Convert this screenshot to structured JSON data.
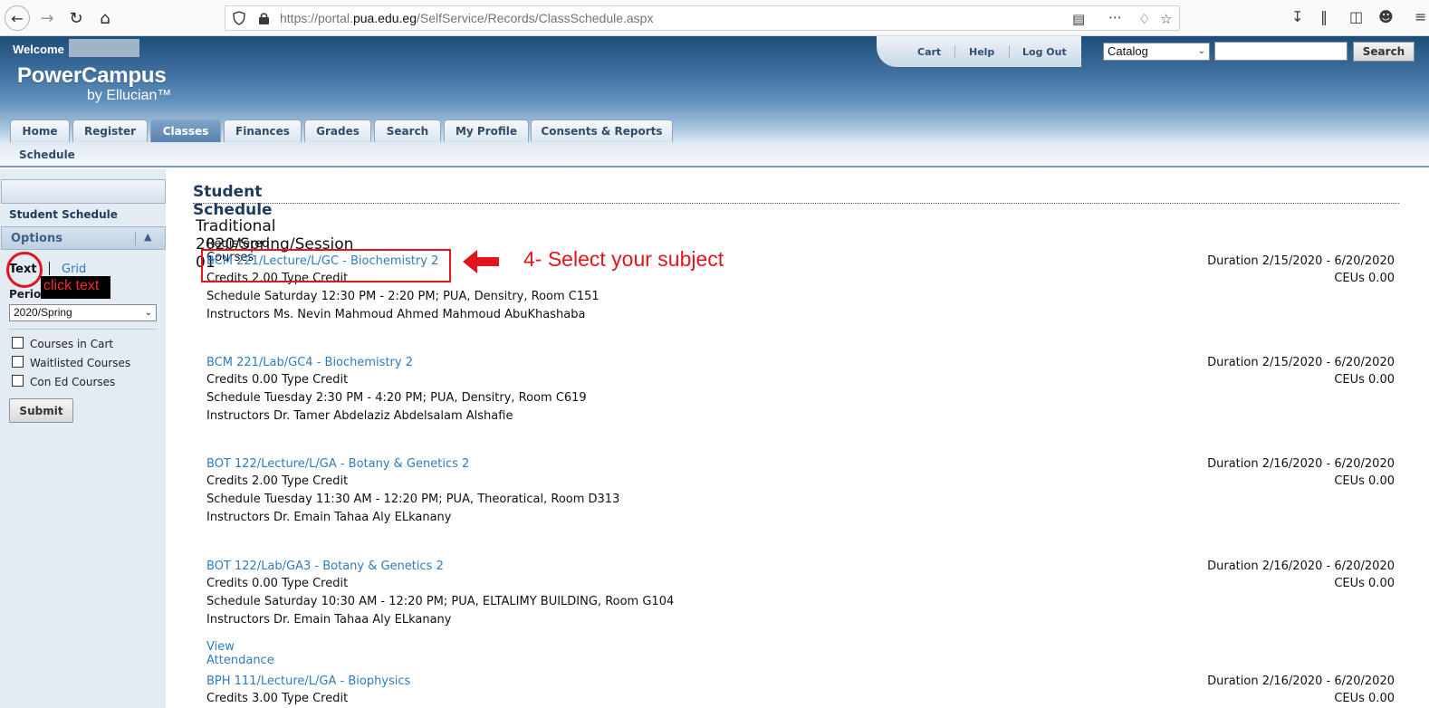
{
  "browser": {
    "url_prefix": "https://portal.",
    "url_domain": "pua.edu.eg",
    "url_path": "/SelfService/Records/ClassSchedule.aspx"
  },
  "header": {
    "welcome": "Welcome",
    "brand": "PowerCampus",
    "brand_sub": "by Ellucian™",
    "links": [
      "Cart",
      "Help",
      "Log Out"
    ],
    "catalog_value": "Catalog",
    "search_label": "Search"
  },
  "tabs": [
    "Home",
    "Register",
    "Classes",
    "Finances",
    "Grades",
    "Search",
    "My Profile",
    "Consents & Reports"
  ],
  "subnav": "Schedule",
  "sidebar": {
    "student_schedule": "Student Schedule",
    "options": "Options",
    "text_view": "Text",
    "grid_view": "Grid",
    "period_label": "Period",
    "period_value": "2020/Spring",
    "checkboxes": [
      "Courses in Cart",
      "Waitlisted Courses",
      "Con Ed Courses"
    ],
    "submit": "Submit"
  },
  "annotations": {
    "click_text": "click text",
    "select_subject": "4- Select your subject"
  },
  "main": {
    "title": "Student Schedule",
    "session": "Traditional 2020/Spring/Session 01",
    "registered": "Registered Courses",
    "view_attendance": "View Attendance",
    "courses": [
      {
        "name": "BCM 221/Lecture/L/GC - Biochemistry 2",
        "credits": "Credits 2.00   Type Credit",
        "schedule": "Schedule Saturday 12:30 PM - 2:20 PM;  PUA, Densitry, Room C151",
        "instructors": "Instructors Ms. Nevin Mahmoud Ahmed Mahmoud AbuKhashaba",
        "duration": "Duration 2/15/2020 - 6/20/2020",
        "ceus": "CEUs 0.00"
      },
      {
        "name": "BCM 221/Lab/GC4 - Biochemistry 2",
        "credits": "Credits 0.00   Type Credit",
        "schedule": "Schedule Tuesday 2:30 PM - 4:20 PM;  PUA, Densitry, Room C619",
        "instructors": "Instructors Dr. Tamer Abdelaziz Abdelsalam Alshafie",
        "duration": "Duration 2/15/2020 - 6/20/2020",
        "ceus": "CEUs 0.00"
      },
      {
        "name": "BOT 122/Lecture/L/GA - Botany & Genetics 2",
        "credits": "Credits 2.00   Type Credit",
        "schedule": "Schedule Tuesday 11:30 AM - 12:20 PM;  PUA, Theoratical, Room D313",
        "instructors": "Instructors Dr. Emain Tahaa Aly ELkanany",
        "duration": "Duration 2/16/2020 - 6/20/2020",
        "ceus": "CEUs 0.00"
      },
      {
        "name": "BOT 122/Lab/GA3 - Botany & Genetics 2",
        "credits": "Credits 0.00   Type Credit",
        "schedule": "Schedule Saturday 10:30 AM - 12:20 PM;  PUA, ELTALIMY BUILDING, Room G104",
        "instructors": "Instructors Dr. Emain Tahaa Aly ELkanany",
        "duration": "Duration 2/16/2020 - 6/20/2020",
        "ceus": "CEUs 0.00"
      },
      {
        "name": "BPH 111/Lecture/L/GA - Biophysics",
        "credits": "Credits 3.00   Type Credit",
        "duration": "Duration 2/16/2020 - 6/20/2020",
        "ceus": "CEUs 0.00"
      }
    ]
  },
  "colors": {
    "link": "#2f7bbd",
    "header_dark": "#1f4d79",
    "annotation_red": "#e2141c"
  }
}
